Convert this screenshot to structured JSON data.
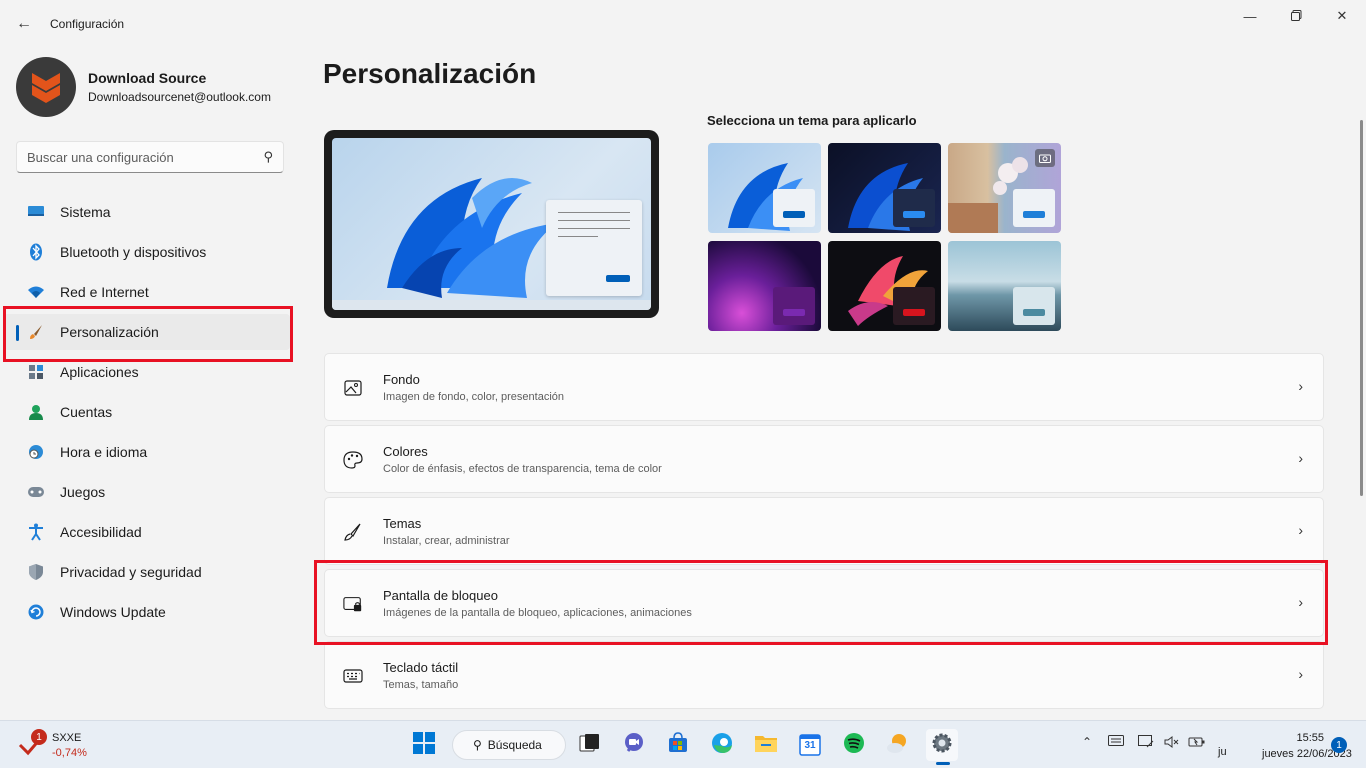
{
  "window": {
    "title": "Configuración",
    "back_icon": "back-arrow-icon",
    "controls": [
      "minimize-icon",
      "maximize-icon",
      "close-icon"
    ]
  },
  "profile": {
    "name": "Download Source",
    "email": "Downloadsourcenet@outlook.com"
  },
  "search": {
    "placeholder": "Buscar una configuración"
  },
  "sidebar": {
    "items": [
      {
        "label": "Sistema",
        "icon": "monitor-icon",
        "active": false
      },
      {
        "label": "Bluetooth y dispositivos",
        "icon": "bluetooth-icon",
        "active": false
      },
      {
        "label": "Red e Internet",
        "icon": "wifi-icon",
        "active": false
      },
      {
        "label": "Personalización",
        "icon": "brush-icon",
        "active": true
      },
      {
        "label": "Aplicaciones",
        "icon": "apps-icon",
        "active": false
      },
      {
        "label": "Cuentas",
        "icon": "person-icon",
        "active": false
      },
      {
        "label": "Hora e idioma",
        "icon": "globe-clock-icon",
        "active": false
      },
      {
        "label": "Juegos",
        "icon": "gamepad-icon",
        "active": false
      },
      {
        "label": "Accesibilidad",
        "icon": "accessibility-icon",
        "active": false
      },
      {
        "label": "Privacidad y seguridad",
        "icon": "shield-icon",
        "active": false
      },
      {
        "label": "Windows Update",
        "icon": "update-icon",
        "active": false
      }
    ]
  },
  "main": {
    "title": "Personalización",
    "themes_title": "Selecciona un tema para aplicarlo",
    "settings": [
      {
        "title": "Fondo",
        "desc": "Imagen de fondo, color, presentación",
        "icon": "image-icon"
      },
      {
        "title": "Colores",
        "desc": "Color de énfasis, efectos de transparencia, tema de color",
        "icon": "palette-icon"
      },
      {
        "title": "Temas",
        "desc": "Instalar, crear, administrar",
        "icon": "brush-icon"
      },
      {
        "title": "Pantalla de bloqueo",
        "desc": "Imágenes de la pantalla de bloqueo, aplicaciones, animaciones",
        "icon": "lock-screen-icon"
      },
      {
        "title": "Teclado táctil",
        "desc": "Temas, tamaño",
        "icon": "keyboard-icon"
      }
    ]
  },
  "taskbar": {
    "stock_name": "SXXE",
    "stock_change": "-0,74%",
    "stock_badge": "1",
    "search_label": "Búsqueda",
    "clock_time": "15:55",
    "clock_date": "jueves 22/06/2023",
    "clock_prefix": "ju",
    "notification_count": "1",
    "calendar_day": "31"
  },
  "colors": {
    "accent": "#005fb8",
    "highlight": "#e81123"
  }
}
